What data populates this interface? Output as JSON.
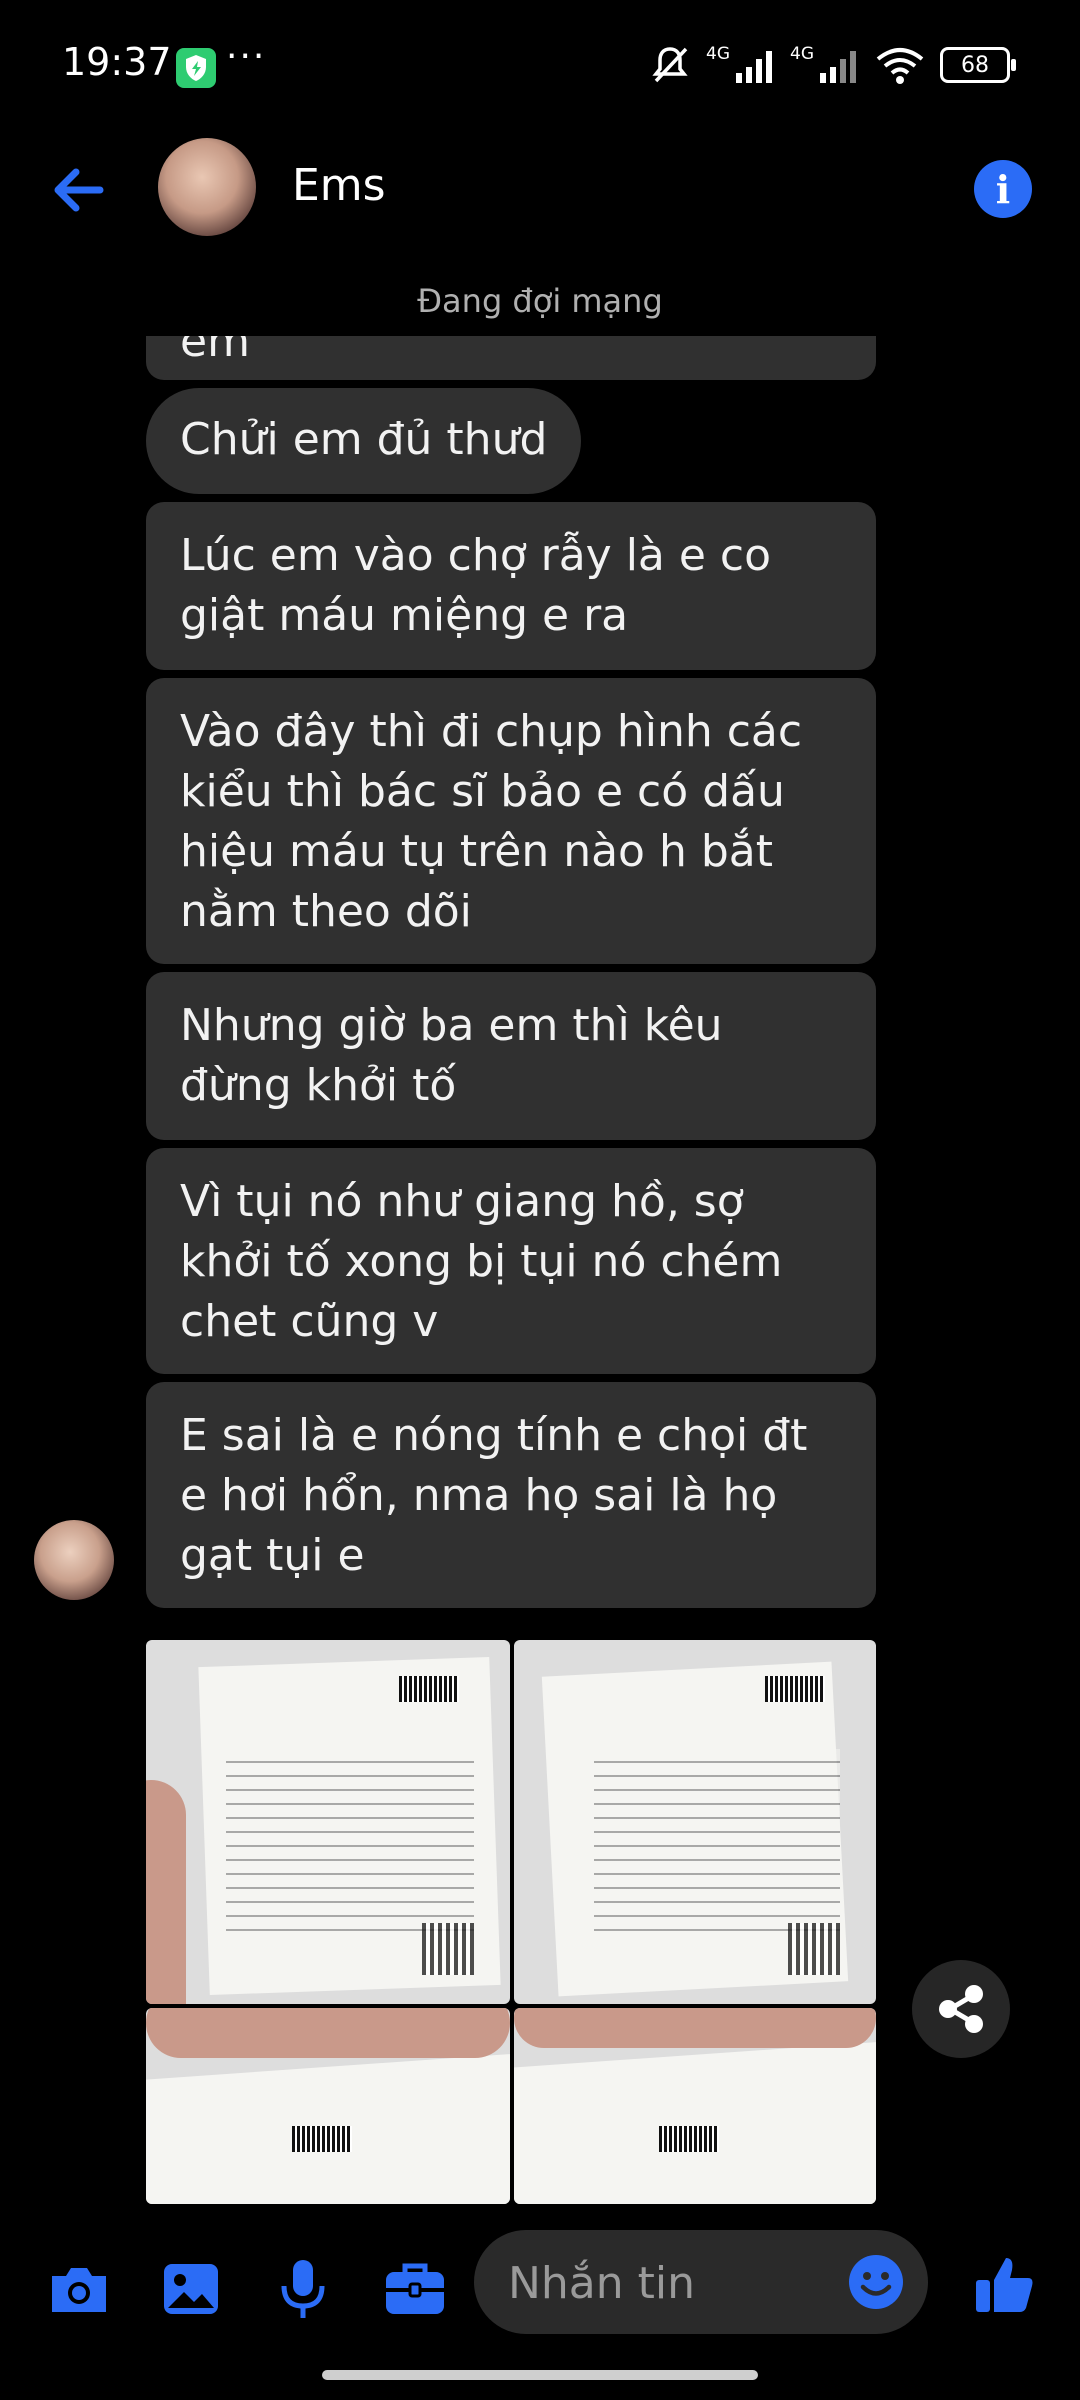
{
  "status_bar": {
    "time": "19:37",
    "dots": "···",
    "network_1": "4G",
    "network_2": "4G",
    "battery": "68"
  },
  "header": {
    "contact_name": "Ems"
  },
  "connection_status": "Đang đợi mạng",
  "messages": [
    {
      "text": "em"
    },
    {
      "text": "Chửi em đủ thưd"
    },
    {
      "text": "Lúc em vào chợ rẫy là e co giật máu miệng e ra"
    },
    {
      "text": "Vào đây thì đi chụp hình các kiểu thì bác sĩ bảo e có dấu hiệu máu tụ trên nào h bắt nằm theo dõi"
    },
    {
      "text": "Nhưng giờ ba em thì kêu đừng khởi tố"
    },
    {
      "text": "Vì tụi nó như giang hồ, sợ khởi tố xong bị tụi nó chém chet cũng v"
    },
    {
      "text": "E sai là e nóng tính e chọi đt e hơi hổn, nma họ sai là họ gạt tụi e"
    }
  ],
  "composer": {
    "placeholder": "Nhắn tin"
  },
  "icons": {
    "back": "arrow-left-icon",
    "info": "info-icon",
    "camera": "camera-icon",
    "gallery": "image-icon",
    "mic": "microphone-icon",
    "apps": "briefcase-icon",
    "emoji": "emoji-icon",
    "like": "thumbs-up-icon",
    "share": "share-icon"
  },
  "colors": {
    "accent": "#2b6cf6",
    "bubble": "#303030",
    "background": "#000000"
  }
}
